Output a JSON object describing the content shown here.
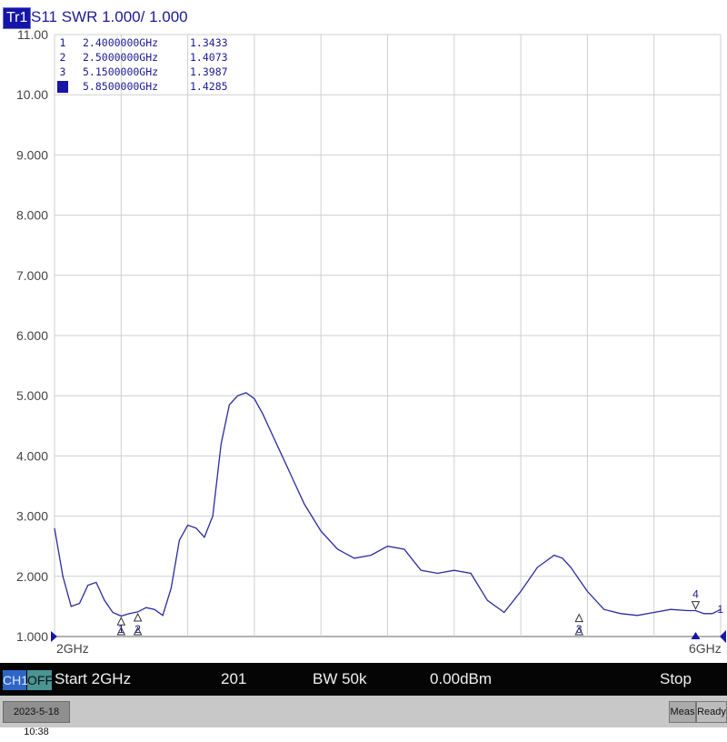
{
  "trace": {
    "badge": "Tr1",
    "description": "S11 SWR 1.000/ 1.000",
    "color": "#2b2b9e"
  },
  "axis": {
    "y_ticks": [
      "11.00",
      "10.00",
      "9.000",
      "8.000",
      "7.000",
      "6.000",
      "5.000",
      "4.000",
      "3.000",
      "2.000",
      "1.000"
    ],
    "x_start_label": "2GHz",
    "x_stop_label": "6GHz"
  },
  "markers": [
    {
      "num": "1",
      "freq": "2.4000000GHz",
      "value": "1.3433",
      "active": false
    },
    {
      "num": "2",
      "freq": "2.5000000GHz",
      "value": "1.4073",
      "active": false
    },
    {
      "num": "3",
      "freq": "5.1500000GHz",
      "value": "1.3987",
      "active": false
    },
    {
      "num": "4",
      "freq": "5.8500000GHz",
      "value": "1.4285",
      "active": true
    }
  ],
  "status": {
    "channel": "CH1",
    "off": "OFF",
    "start": "Start 2GHz",
    "points": "201",
    "bw": "BW 50k",
    "power": "0.00dBm",
    "stop": "Stop 6GHz"
  },
  "footer": {
    "datetime": "2023-5-18 10:38",
    "meas": "Meas",
    "ready": "Ready"
  },
  "chart_data": {
    "type": "line",
    "title": "S11 SWR 1.000/ 1.000",
    "xlabel": "",
    "ylabel": "",
    "xlim": [
      2.0,
      6.0
    ],
    "ylim": [
      1.0,
      11.0
    ],
    "grid": true,
    "x_unit": "GHz",
    "series": [
      {
        "x": [
          2.0,
          2.05,
          2.1,
          2.15,
          2.2,
          2.25,
          2.3,
          2.35,
          2.4,
          2.45,
          2.5,
          2.55,
          2.6,
          2.65,
          2.7,
          2.75,
          2.8,
          2.85,
          2.9,
          2.95,
          3.0,
          3.05,
          3.1,
          3.15,
          3.2,
          3.25,
          3.3,
          3.35,
          3.4,
          3.45,
          3.5,
          3.6,
          3.7,
          3.8,
          3.9,
          4.0,
          4.1,
          4.2,
          4.3,
          4.4,
          4.5,
          4.6,
          4.7,
          4.8,
          4.9,
          5.0,
          5.05,
          5.1,
          5.15,
          5.2,
          5.3,
          5.4,
          5.5,
          5.6,
          5.7,
          5.8,
          5.85,
          5.9,
          5.95,
          6.0
        ],
        "y": [
          2.8,
          2.0,
          1.5,
          1.55,
          1.85,
          1.9,
          1.6,
          1.4,
          1.34,
          1.38,
          1.41,
          1.48,
          1.45,
          1.35,
          1.8,
          2.6,
          2.85,
          2.8,
          2.65,
          3.0,
          4.2,
          4.85,
          5.0,
          5.05,
          4.95,
          4.7,
          4.4,
          4.1,
          3.8,
          3.5,
          3.2,
          2.75,
          2.45,
          2.3,
          2.35,
          2.5,
          2.45,
          2.1,
          2.05,
          2.1,
          2.05,
          1.6,
          1.4,
          1.75,
          2.15,
          2.35,
          2.3,
          2.15,
          1.95,
          1.75,
          1.45,
          1.38,
          1.35,
          1.4,
          1.45,
          1.43,
          1.43,
          1.38,
          1.38,
          1.45
        ]
      }
    ],
    "markers": [
      {
        "label": "1",
        "x": 2.4,
        "y": 1.3433
      },
      {
        "label": "2",
        "x": 2.5,
        "y": 1.4073
      },
      {
        "label": "3",
        "x": 5.15,
        "y": 1.3987
      },
      {
        "label": "4",
        "x": 5.85,
        "y": 1.4285
      }
    ]
  }
}
